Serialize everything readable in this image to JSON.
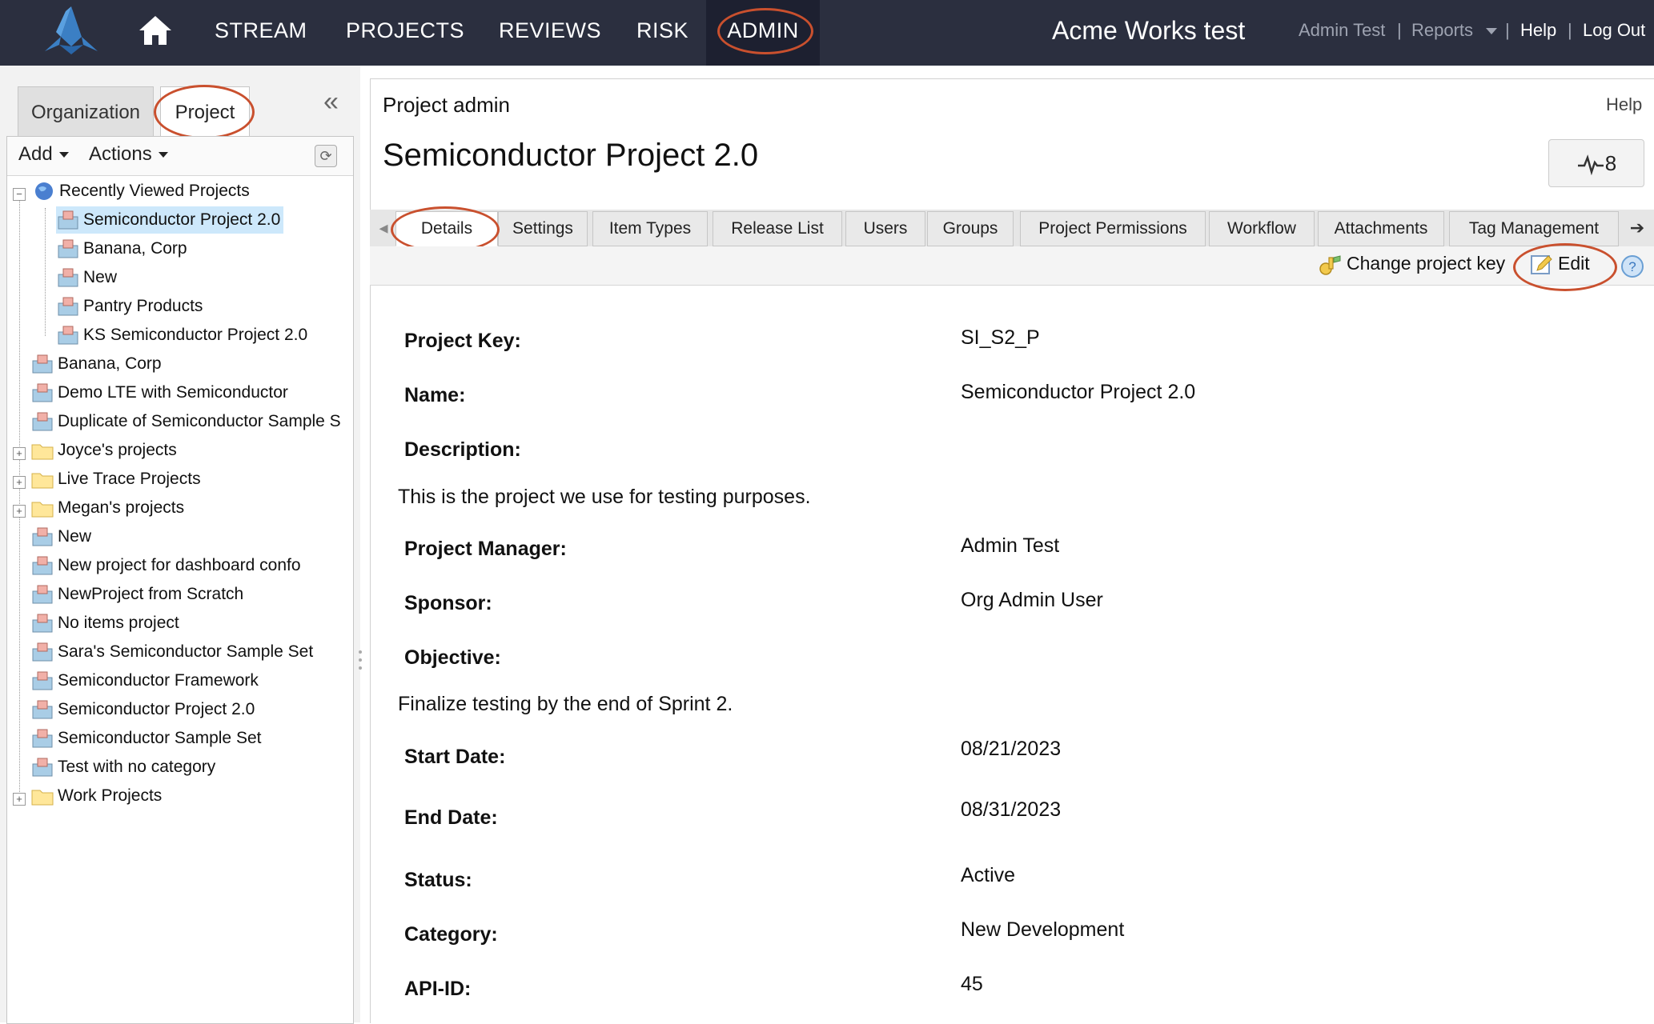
{
  "topnav": {
    "items": [
      "STREAM",
      "PROJECTS",
      "REVIEWS",
      "RISK",
      "ADMIN"
    ],
    "app_title": "Acme Works test",
    "user": "Admin Test",
    "reports": "Reports",
    "help": "Help",
    "logout": "Log Out",
    "separator": "|"
  },
  "leftpanel": {
    "tabs": [
      "Organization",
      "Project"
    ],
    "collapse": "«",
    "toolbar": {
      "add": "Add",
      "actions": "Actions"
    },
    "tree": [
      {
        "label": "Recently Viewed Projects",
        "icon": "globe-icon"
      },
      {
        "label": "Semiconductor Project 2.0",
        "icon": "project-icon"
      },
      {
        "label": "Banana, Corp",
        "icon": "project-icon"
      },
      {
        "label": "New",
        "icon": "project-icon"
      },
      {
        "label": "Pantry Products",
        "icon": "project-icon"
      },
      {
        "label": "KS Semiconductor Project 2.0",
        "icon": "project-icon"
      },
      {
        "label": "Banana, Corp",
        "icon": "project-icon"
      },
      {
        "label": "Demo LTE with Semiconductor",
        "icon": "project-icon"
      },
      {
        "label": "Duplicate of Semiconductor Sample S",
        "icon": "project-icon"
      },
      {
        "label": "Joyce's projects",
        "icon": "folder-icon"
      },
      {
        "label": "Live Trace Projects",
        "icon": "folder-icon"
      },
      {
        "label": "Megan's projects",
        "icon": "folder-icon"
      },
      {
        "label": "New",
        "icon": "project-icon"
      },
      {
        "label": "New project for dashboard confo",
        "icon": "project-icon"
      },
      {
        "label": "NewProject from Scratch",
        "icon": "project-icon"
      },
      {
        "label": "No items project",
        "icon": "project-icon"
      },
      {
        "label": "Sara's Semiconductor Sample Set",
        "icon": "project-icon"
      },
      {
        "label": "Semiconductor Framework",
        "icon": "project-icon"
      },
      {
        "label": "Semiconductor Project 2.0",
        "icon": "project-icon"
      },
      {
        "label": "Semiconductor Sample Set",
        "icon": "project-icon"
      },
      {
        "label": "Test with no category",
        "icon": "project-icon"
      },
      {
        "label": "Work Projects",
        "icon": "folder-icon"
      }
    ]
  },
  "main": {
    "section": "Project admin",
    "help": "Help",
    "title": "Semiconductor Project 2.0",
    "activity_count": "8",
    "tabs": [
      "Details",
      "Settings",
      "Item Types",
      "Release List",
      "Users",
      "Groups",
      "Project Permissions",
      "Workflow",
      "Attachments",
      "Tag Management"
    ],
    "actions": {
      "change_key": "Change project key",
      "edit": "Edit"
    },
    "fields": {
      "project_key": {
        "label": "Project Key:",
        "value": "SI_S2_P"
      },
      "name": {
        "label": "Name:",
        "value": "Semiconductor Project 2.0"
      },
      "description": {
        "label": "Description:",
        "value": "This is the project we use for testing purposes."
      },
      "manager": {
        "label": "Project Manager:",
        "value": "Admin Test"
      },
      "sponsor": {
        "label": "Sponsor:",
        "value": "Org Admin User"
      },
      "objective": {
        "label": "Objective:",
        "value": "Finalize testing by the end of Sprint 2."
      },
      "start": {
        "label": "Start Date:",
        "value": "08/21/2023"
      },
      "end": {
        "label": "End Date:",
        "value": "08/31/2023"
      },
      "status": {
        "label": "Status:",
        "value": "Active"
      },
      "category": {
        "label": "Category:",
        "value": "New Development"
      },
      "api_id": {
        "label": "API-ID:",
        "value": "45"
      }
    }
  },
  "colors": {
    "topbar": "#2b2f3f",
    "highlight": "#c9502e",
    "selected": "#cde8fb"
  }
}
